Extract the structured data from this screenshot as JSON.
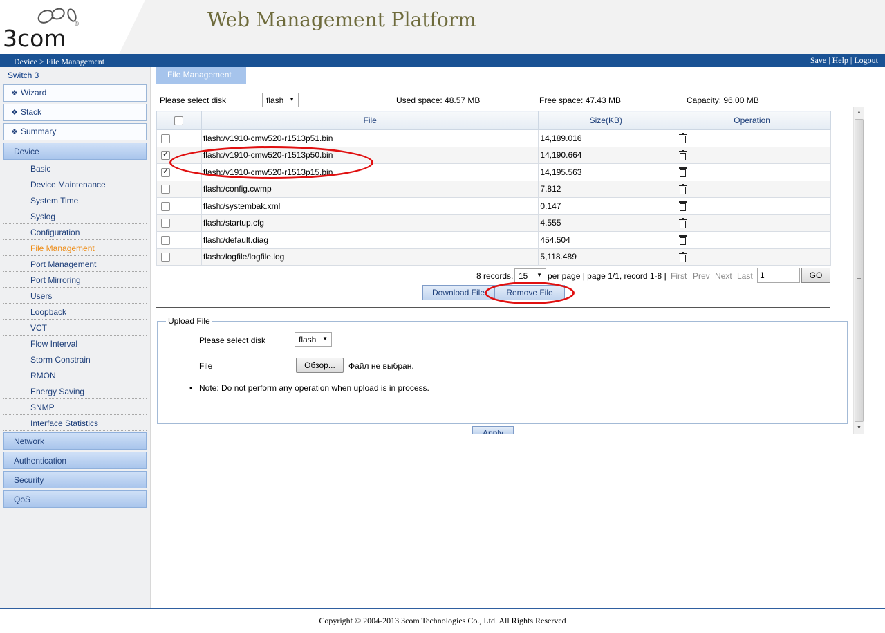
{
  "header": {
    "logo": "3com",
    "logo_mark": "®",
    "platform_title": "Web Management Platform",
    "breadcrumb": "Device > File Management",
    "links": {
      "save": "Save",
      "help": "Help",
      "logout": "Logout",
      "sep": "|"
    }
  },
  "sidebar": {
    "switch_name": "Switch 3",
    "top_items": [
      {
        "label": "Wizard"
      },
      {
        "label": "Stack"
      },
      {
        "label": "Summary"
      }
    ],
    "device_category": "Device",
    "device_items": [
      {
        "label": "Basic"
      },
      {
        "label": "Device Maintenance"
      },
      {
        "label": "System Time"
      },
      {
        "label": "Syslog"
      },
      {
        "label": "Configuration"
      },
      {
        "label": "File Management",
        "active": true
      },
      {
        "label": "Port Management"
      },
      {
        "label": "Port Mirroring"
      },
      {
        "label": "Users"
      },
      {
        "label": "Loopback"
      },
      {
        "label": "VCT"
      },
      {
        "label": "Flow Interval"
      },
      {
        "label": "Storm Constrain"
      },
      {
        "label": "RMON"
      },
      {
        "label": "Energy Saving"
      },
      {
        "label": "SNMP"
      },
      {
        "label": "Interface Statistics"
      }
    ],
    "bottom_categories": [
      {
        "label": "Network"
      },
      {
        "label": "Authentication"
      },
      {
        "label": "Security"
      },
      {
        "label": "QoS"
      }
    ]
  },
  "main": {
    "tab": "File Management",
    "disk_label": "Please select disk",
    "disk_value": "flash",
    "used_space": "Used space: 48.57 MB",
    "free_space": "Free space: 47.43 MB",
    "capacity": "Capacity: 96.00 MB",
    "table": {
      "headers": {
        "file": "File",
        "size": "Size(KB)",
        "operation": "Operation"
      },
      "rows": [
        {
          "file": "flash:/v1910-cmw520-r1513p51.bin",
          "size": "14,189.016",
          "checked": false
        },
        {
          "file": "flash:/v1910-cmw520-r1513p50.bin",
          "size": "14,190.664",
          "checked": true
        },
        {
          "file": "flash:/v1910-cmw520-r1513p15.bin",
          "size": "14,195.563",
          "checked": true
        },
        {
          "file": "flash:/config.cwmp",
          "size": "7.812",
          "checked": false
        },
        {
          "file": "flash:/systembak.xml",
          "size": "0.147",
          "checked": false
        },
        {
          "file": "flash:/startup.cfg",
          "size": "4.555",
          "checked": false
        },
        {
          "file": "flash:/default.diag",
          "size": "454.504",
          "checked": false
        },
        {
          "file": "flash:/logfile/logfile.log",
          "size": "5,118.489",
          "checked": false
        }
      ]
    },
    "pager": {
      "records": "8 records,",
      "per_page_value": "15",
      "per_page_text": "per page | page 1/1, record 1-8 |",
      "first": "First",
      "prev": "Prev",
      "next": "Next",
      "last": "Last",
      "page_input": "1",
      "go": "GO"
    },
    "download_button": "Download File",
    "remove_button": "Remove File",
    "upload": {
      "legend": "Upload File",
      "disk_label": "Please select disk",
      "disk_value": "flash",
      "file_label": "File",
      "browse_button": "Обзор...",
      "no_file": "Файл не выбран.",
      "note": "Note: Do not perform any operation when upload is in process.",
      "apply_button": "Apply"
    }
  },
  "footer": {
    "copyright": "Copyright © 2004-2013 3com Technologies Co., Ltd. All Rights Reserved"
  },
  "colors": {
    "header_bar": "#1a5294",
    "active_nav": "#ee8c16",
    "annotation_circle": "#e01010"
  }
}
